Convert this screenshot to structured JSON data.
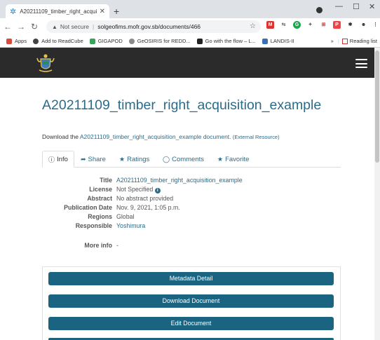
{
  "browser": {
    "tab_title": "A20211109_timber_right_acquisit",
    "url_security": "Not secure",
    "url": "solgeofims.mofr.gov.sb/documents/466",
    "bookmarks": [
      {
        "label": "Apps",
        "color": "#d94a3a"
      },
      {
        "label": "Add to ReadCube",
        "color": "#444444"
      },
      {
        "label": "GIGAPOD",
        "color": "#3aa35a"
      },
      {
        "label": "GeOSIRIS for REDD...",
        "color": "#8a8a8a"
      },
      {
        "label": "Go with the flow – L...",
        "color": "#222222"
      },
      {
        "label": "LANDIS-II",
        "color": "#3b6fb5"
      }
    ],
    "bookmarks_overflow": "»",
    "reading_list": "Reading list"
  },
  "page": {
    "title": "A20211109_timber_right_acquisition_example",
    "download_prefix": "Download the",
    "download_link": "A20211109_timber_right_acquisition_example document.",
    "external_resource": "(External Resource)",
    "tabs": [
      {
        "label": "Info",
        "icon": "info-circle-icon",
        "glyph": "ℹ"
      },
      {
        "label": "Share",
        "icon": "share-arrow-icon",
        "glyph": "➦"
      },
      {
        "label": "Ratings",
        "icon": "star-icon",
        "glyph": "★"
      },
      {
        "label": "Comments",
        "icon": "comment-icon",
        "glyph": "💬"
      },
      {
        "label": "Favorite",
        "icon": "star-icon",
        "glyph": "★"
      }
    ],
    "info": {
      "title_label": "Title",
      "title_value": "A20211109_timber_right_acquisition_example",
      "license_label": "License",
      "license_value": "Not Specified",
      "abstract_label": "Abstract",
      "abstract_value": "No abstract provided",
      "pubdate_label": "Publication Date",
      "pubdate_value": "Nov. 9, 2021, 1:05 p.m.",
      "regions_label": "Regions",
      "regions_value": "Global",
      "responsible_label": "Responsible",
      "responsible_value": "Yoshimura",
      "moreinfo_label": "More info",
      "moreinfo_value": "-"
    },
    "actions": {
      "metadata": "Metadata Detail",
      "download": "Download Document",
      "edit": "Edit Document"
    }
  },
  "colors": {
    "accent": "#2c6b8a",
    "button": "#1a6381",
    "header": "#2b2b2b"
  }
}
